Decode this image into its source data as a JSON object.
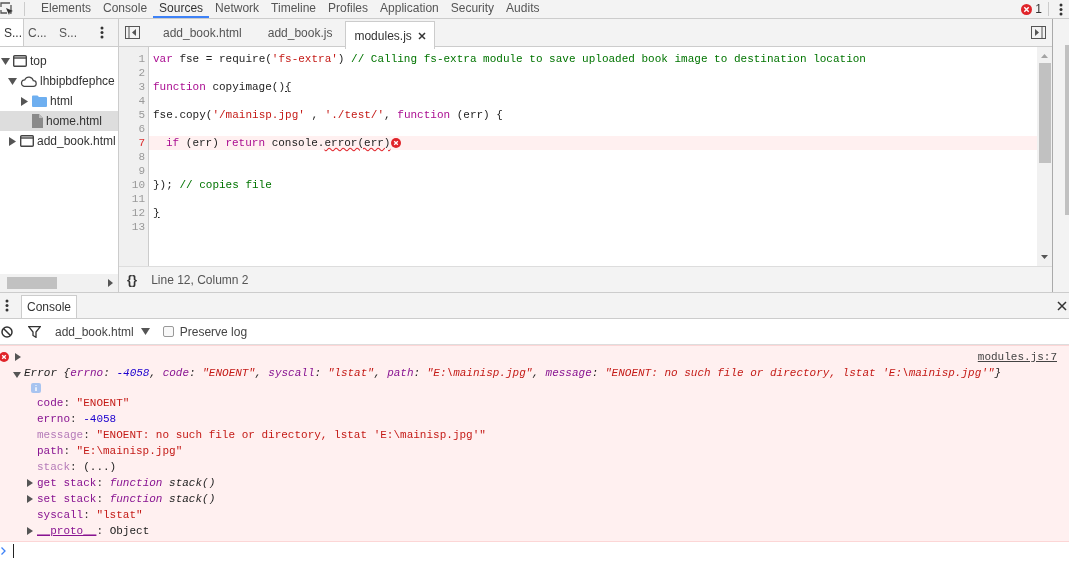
{
  "main_tabs": [
    {
      "label": "Elements",
      "selected": false
    },
    {
      "label": "Console",
      "selected": false
    },
    {
      "label": "Sources",
      "selected": true
    },
    {
      "label": "Network",
      "selected": false
    },
    {
      "label": "Timeline",
      "selected": false
    },
    {
      "label": "Profiles",
      "selected": false
    },
    {
      "label": "Application",
      "selected": false
    },
    {
      "label": "Security",
      "selected": false
    },
    {
      "label": "Audits",
      "selected": false
    }
  ],
  "error_count": "1",
  "navigator_tabs": [
    {
      "label": "S...",
      "selected": true
    },
    {
      "label": "C...",
      "selected": false
    },
    {
      "label": "S...",
      "selected": false
    }
  ],
  "tree": [
    {
      "label": "top",
      "kind": "frame",
      "expanded": true,
      "selected": false,
      "children": [
        {
          "label": "lhbipbdfephce",
          "kind": "cloud",
          "expanded": true,
          "selected": false,
          "children": [
            {
              "label": "html",
              "kind": "folder",
              "expanded": false,
              "selected": false
            },
            {
              "label": "home.html",
              "kind": "file",
              "selected": true
            }
          ]
        },
        {
          "label": "add_book.html",
          "kind": "frame",
          "expanded": false,
          "selected": false
        }
      ]
    }
  ],
  "editor_tabs": [
    {
      "label": "add_book.html",
      "selected": false,
      "closable": false
    },
    {
      "label": "add_book.js",
      "selected": false,
      "closable": false
    },
    {
      "label": "modules.js",
      "selected": true,
      "closable": true
    }
  ],
  "code_lines": [
    {
      "number": "1",
      "error": false,
      "tokens": [
        {
          "kind": "keyword",
          "text": "var"
        },
        {
          "kind": "plain",
          "text": " fse = require("
        },
        {
          "kind": "string",
          "text": "'fs-extra'"
        },
        {
          "kind": "plain",
          "text": ") "
        },
        {
          "kind": "comment",
          "text": "// Calling fs-extra module to save uploaded book image to destination location"
        }
      ]
    },
    {
      "number": "2",
      "error": false
    },
    {
      "number": "3",
      "error": false,
      "tokens": [
        {
          "kind": "keyword",
          "text": "function"
        },
        {
          "kind": "plain",
          "text": " copyimage()"
        },
        {
          "kind": "bracket",
          "text": "{"
        }
      ]
    },
    {
      "number": "4",
      "error": false
    },
    {
      "number": "5",
      "error": false,
      "tokens": [
        {
          "kind": "plain",
          "text": "fse.copy("
        },
        {
          "kind": "string",
          "text": "'/mainisp.jpg'"
        },
        {
          "kind": "plain",
          "text": " , "
        },
        {
          "kind": "string",
          "text": "'./test/'"
        },
        {
          "kind": "plain",
          "text": ", "
        },
        {
          "kind": "keyword",
          "text": "function"
        },
        {
          "kind": "plain",
          "text": " (err) {"
        }
      ]
    },
    {
      "number": "6",
      "error": false
    },
    {
      "number": "7",
      "error": true,
      "indented": true,
      "tokens": [
        {
          "kind": "keyword",
          "text": "if"
        },
        {
          "kind": "plain",
          "text": " (err) "
        },
        {
          "kind": "keyword",
          "text": "return"
        },
        {
          "kind": "plain",
          "text": " console."
        },
        {
          "kind": "squiggle",
          "text": "error(err)"
        }
      ]
    },
    {
      "number": "8",
      "error": false
    },
    {
      "number": "9",
      "error": false
    },
    {
      "number": "10",
      "error": false,
      "tokens": [
        {
          "kind": "plain",
          "text": "}); "
        },
        {
          "kind": "comment",
          "text": "// copies file"
        }
      ]
    },
    {
      "number": "11",
      "error": false
    },
    {
      "number": "12",
      "error": false,
      "tokens": [
        {
          "kind": "bracket",
          "text": "}"
        }
      ]
    },
    {
      "number": "13",
      "error": false
    }
  ],
  "status_bar": {
    "format_button": "{}",
    "position": "Line 12, Column 2"
  },
  "drawer_tabs": [
    {
      "label": "Console",
      "selected": true
    }
  ],
  "console_toolbar": {
    "context": "add_book.html",
    "preserve_log": {
      "label": "Preserve log",
      "checked": false
    }
  },
  "console_message": {
    "source": "modules.js:7",
    "expanded": true,
    "separator": ":",
    "summary": [
      {
        "kind": "plain",
        "text": "Error {"
      },
      {
        "kind": "key",
        "text": "errno"
      },
      {
        "kind": "plain",
        "text": ": "
      },
      {
        "kind": "number",
        "text": "-4058"
      },
      {
        "kind": "plain",
        "text": ", "
      },
      {
        "kind": "key",
        "text": "code"
      },
      {
        "kind": "plain",
        "text": ": "
      },
      {
        "kind": "string",
        "text": "\"ENOENT\""
      },
      {
        "kind": "plain",
        "text": ", "
      },
      {
        "kind": "key",
        "text": "syscall"
      },
      {
        "kind": "plain",
        "text": ": "
      },
      {
        "kind": "string",
        "text": "\"lstat\""
      },
      {
        "kind": "plain",
        "text": ", "
      },
      {
        "kind": "key",
        "text": "path"
      },
      {
        "kind": "plain",
        "text": ": "
      },
      {
        "kind": "string",
        "text": "\"E:\\mainisp.jpg\""
      },
      {
        "kind": "plain",
        "text": ", "
      },
      {
        "kind": "key",
        "text": "message"
      },
      {
        "kind": "plain",
        "text": ": "
      },
      {
        "kind": "string",
        "text": "\"ENOENT: no such file or directory, lstat 'E:\\mainisp.jpg'\""
      },
      {
        "kind": "plain",
        "text": "}"
      }
    ],
    "properties": [
      {
        "key": "code",
        "value": "\"ENOENT\"",
        "kind": "string",
        "dim": false,
        "expandable": false
      },
      {
        "key": "errno",
        "value": "-4058",
        "kind": "number",
        "dim": false,
        "expandable": false
      },
      {
        "key": "message",
        "value": "\"ENOENT: no such file or directory, lstat 'E:\\mainisp.jpg'\"",
        "kind": "string",
        "dim": true,
        "expandable": false
      },
      {
        "key": "path",
        "value": "\"E:\\mainisp.jpg\"",
        "kind": "string",
        "dim": false,
        "expandable": false
      },
      {
        "key": "stack",
        "value": "(...)",
        "kind": "plain",
        "dim": true,
        "expandable": false
      },
      {
        "key": "get stack",
        "value": "function stack()",
        "kind": "function",
        "dim": false,
        "expandable": true
      },
      {
        "key": "set stack",
        "value": "function stack()",
        "kind": "function",
        "dim": false,
        "expandable": true
      },
      {
        "key": "syscall",
        "value": "\"lstat\"",
        "kind": "string",
        "dim": false,
        "expandable": false
      },
      {
        "key": "__proto__",
        "value": "Object",
        "kind": "plain",
        "dim": false,
        "expandable": true
      }
    ]
  }
}
